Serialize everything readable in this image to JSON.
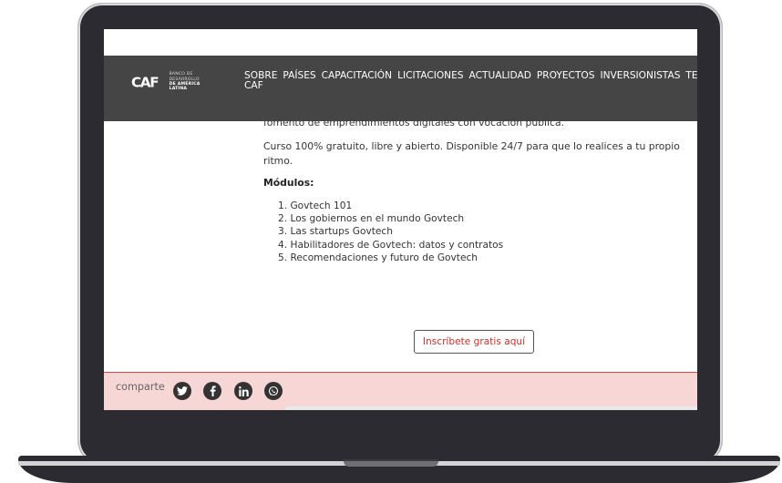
{
  "navbar": {
    "logo": {
      "mark": "CAF",
      "sub_line1": "BANCO DE DESARROLLO",
      "sub_line2": "DE AMÉRICA LATINA"
    },
    "items": [
      {
        "label": "SOBRE",
        "sub": "CAF"
      },
      {
        "label": "PAÍSES"
      },
      {
        "label": "CAPACITACIÓN"
      },
      {
        "label": "LICITACIONES"
      },
      {
        "label": "ACTUALIDAD"
      },
      {
        "label": "PROYECTOS"
      },
      {
        "label": "INVERSIONISTAS"
      },
      {
        "label": "TEM"
      }
    ]
  },
  "content": {
    "cut_text": "fomento de emprendimientos digitales con vocación pública.",
    "paragraph": "Curso 100% gratuito, libre y abierto. Disponible 24/7 para que lo realices a tu propio ritmo.",
    "modules_title": "Módulos:",
    "modules": [
      "1. Govtech 101",
      "2. Los gobiernos en el mundo Govtech",
      "3. Las startups Govtech",
      "4. Habilitadores de Govtech: datos y contratos",
      "5. Recomendaciones y futuro de Govtech"
    ],
    "cta_label": "Inscríbete gratis aquí"
  },
  "share": {
    "label": "comparte",
    "icons": [
      "twitter-icon",
      "facebook-icon",
      "linkedin-icon",
      "whatsapp-icon"
    ]
  },
  "colors": {
    "navbar_bg": "#454545",
    "share_bg": "#f6d7d5",
    "accent_red": "#d94a3d",
    "laptop_frame": "#2b2b31"
  }
}
